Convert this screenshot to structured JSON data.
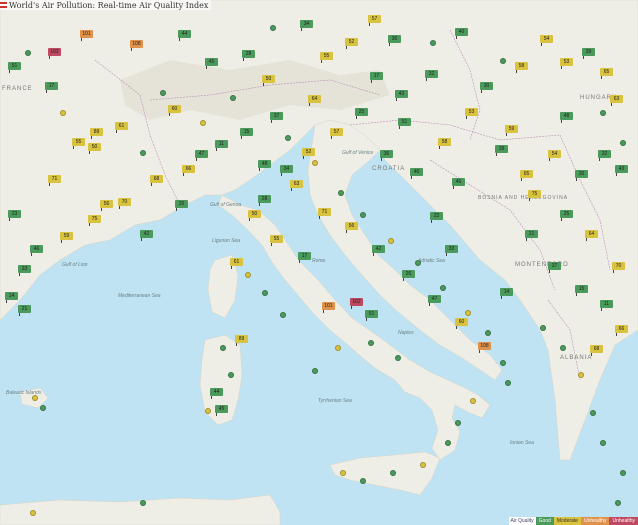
{
  "title": "World's Air Pollution: Real-time Air Quality Index",
  "legend": {
    "title": "Air Quality",
    "levels": [
      {
        "label": "Good",
        "color": "#4a9a5c"
      },
      {
        "label": "Moderate",
        "color": "#d9c23d"
      },
      {
        "label": "Unhealthy for Sensitive Groups",
        "short": "Unhealthy",
        "color": "#e0924a"
      },
      {
        "label": "Unhealthy",
        "short": "Unhealthy",
        "color": "#c04860"
      }
    ]
  },
  "colors": {
    "sea": "#bfe3f2",
    "land": "#efeee6",
    "good": "#4a9a5c",
    "moderate": "#d9c23d",
    "sensitive": "#e0924a",
    "unhealthy": "#c04860"
  },
  "countries": [
    "FRANCE",
    "HUNGARY",
    "CROATIA",
    "BOSNIA AND HERZEGOVINA",
    "MONTENEGRO",
    "ALBANIA"
  ],
  "places": [
    "Gulf of Lion",
    "Mediterranean Sea",
    "Ligurian Sea",
    "Tyrrhenian Sea",
    "Adriatic Sea",
    "Gulf of Venice",
    "Gulf of Genoa",
    "Ionian Sea",
    "Balearic Islands",
    "Rome",
    "Naples"
  ],
  "markers": [
    {
      "aqi": "51",
      "level": "good"
    },
    {
      "aqi": "17",
      "level": "good"
    },
    {
      "aqi": "55",
      "level": "moderate"
    },
    {
      "aqi": "50",
      "level": "moderate"
    },
    {
      "aqi": "61",
      "level": "moderate"
    },
    {
      "aqi": "89",
      "level": "moderate"
    },
    {
      "aqi": "44",
      "level": "good"
    },
    {
      "aqi": "45",
      "level": "good"
    },
    {
      "aqi": "28",
      "level": "good"
    },
    {
      "aqi": "34",
      "level": "good"
    },
    {
      "aqi": "52",
      "level": "moderate"
    },
    {
      "aqi": "57",
      "level": "moderate"
    },
    {
      "aqi": "36",
      "level": "good"
    },
    {
      "aqi": "40",
      "level": "good"
    },
    {
      "aqi": "58",
      "level": "moderate"
    },
    {
      "aqi": "53",
      "level": "moderate"
    },
    {
      "aqi": "39",
      "level": "good"
    },
    {
      "aqi": "65",
      "level": "moderate"
    },
    {
      "aqi": "54",
      "level": "moderate"
    },
    {
      "aqi": "30",
      "level": "good"
    },
    {
      "aqi": "32",
      "level": "good"
    },
    {
      "aqi": "43",
      "level": "good"
    },
    {
      "aqi": "25",
      "level": "good"
    },
    {
      "aqi": "64",
      "level": "moderate"
    },
    {
      "aqi": "37",
      "level": "good"
    },
    {
      "aqi": "15",
      "level": "good"
    },
    {
      "aqi": "11",
      "level": "good"
    },
    {
      "aqi": "66",
      "level": "moderate"
    },
    {
      "aqi": "68",
      "level": "moderate"
    },
    {
      "aqi": "70",
      "level": "moderate"
    },
    {
      "aqi": "75",
      "level": "moderate"
    },
    {
      "aqi": "59",
      "level": "moderate"
    },
    {
      "aqi": "46",
      "level": "good"
    },
    {
      "aqi": "23",
      "level": "good"
    },
    {
      "aqi": "33",
      "level": "good"
    },
    {
      "aqi": "14",
      "level": "good"
    },
    {
      "aqi": "21",
      "level": "good"
    },
    {
      "aqi": "48",
      "level": "good"
    },
    {
      "aqi": "63",
      "level": "moderate"
    },
    {
      "aqi": "71",
      "level": "moderate"
    },
    {
      "aqi": "56",
      "level": "moderate"
    },
    {
      "aqi": "42",
      "level": "good"
    },
    {
      "aqi": "26",
      "level": "good"
    },
    {
      "aqi": "47",
      "level": "good"
    },
    {
      "aqi": "60",
      "level": "moderate"
    },
    {
      "aqi": "108",
      "level": "sensitive"
    },
    {
      "aqi": "101",
      "level": "sensitive"
    },
    {
      "aqi": "162",
      "level": "unhealthy"
    }
  ]
}
